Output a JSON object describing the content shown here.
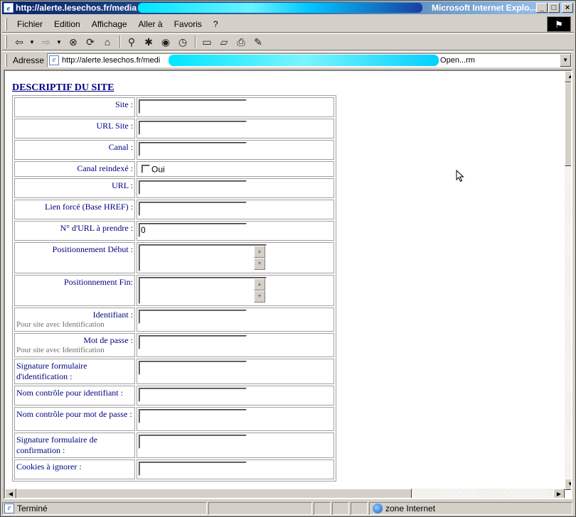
{
  "window": {
    "title_url": "http://alerte.lesechos.fr/media",
    "app_name": "Microsoft Internet Explo...",
    "controls": {
      "minimize": "_",
      "maximize": "□",
      "close": "×"
    }
  },
  "menu": {
    "items": [
      {
        "label": "Fichier"
      },
      {
        "label": "Edition"
      },
      {
        "label": "Affichage"
      },
      {
        "label": "Aller à"
      },
      {
        "label": "Favoris"
      },
      {
        "label": "?"
      }
    ]
  },
  "toolbar": {
    "icons": [
      "back-icon",
      "forward-icon",
      "stop-icon",
      "refresh-icon",
      "home-icon",
      "search-icon",
      "favorites-icon",
      "media-icon",
      "history-icon",
      "fullscreen-icon",
      "folder-icon",
      "print-icon",
      "edit-icon"
    ]
  },
  "address": {
    "label": "Adresse",
    "url_start": "http://alerte.lesechos.fr/medi",
    "url_end": "Open...rm"
  },
  "form": {
    "section_title": "DESCRIPTIF DU SITE",
    "fields": {
      "site": {
        "label": "Site :",
        "value": ""
      },
      "url_site": {
        "label": "URL Site :",
        "value": ""
      },
      "canal": {
        "label": "Canal :",
        "value": ""
      },
      "canal_reindexe": {
        "label": "Canal reindexé :",
        "option": "Oui",
        "checked": false
      },
      "url": {
        "label": "URL :",
        "value": ""
      },
      "lien_force": {
        "label": "Lien forcé (Base HREF) :",
        "value": ""
      },
      "num_url": {
        "label": "N° d'URL à prendre :",
        "value": "0"
      },
      "pos_debut": {
        "label": "Positionnement Début :",
        "value": ""
      },
      "pos_fin": {
        "label": "Positionnement Fin:",
        "value": ""
      },
      "identifiant": {
        "label": "Identifiant :",
        "hint": "Pour site avec Identification",
        "value": ""
      },
      "mot_de_passe": {
        "label": "Mot de passe :",
        "hint": "Pour site avec Identification",
        "value": ""
      },
      "signature_ident": {
        "label": "Signature formulaire d'identification :",
        "value": ""
      },
      "nom_ctrl_ident": {
        "label": "Nom contrôle pour identifiant :",
        "value": ""
      },
      "nom_ctrl_mdp": {
        "label": "Nom contrôle pour mot de passe :",
        "value": ""
      },
      "signature_confirm": {
        "label": "Signature formulaire de confirmation :",
        "value": ""
      },
      "cookies": {
        "label": "Cookies à ignorer :",
        "value": ""
      }
    }
  },
  "status": {
    "text": "Terminé",
    "zone": "zone Internet"
  }
}
